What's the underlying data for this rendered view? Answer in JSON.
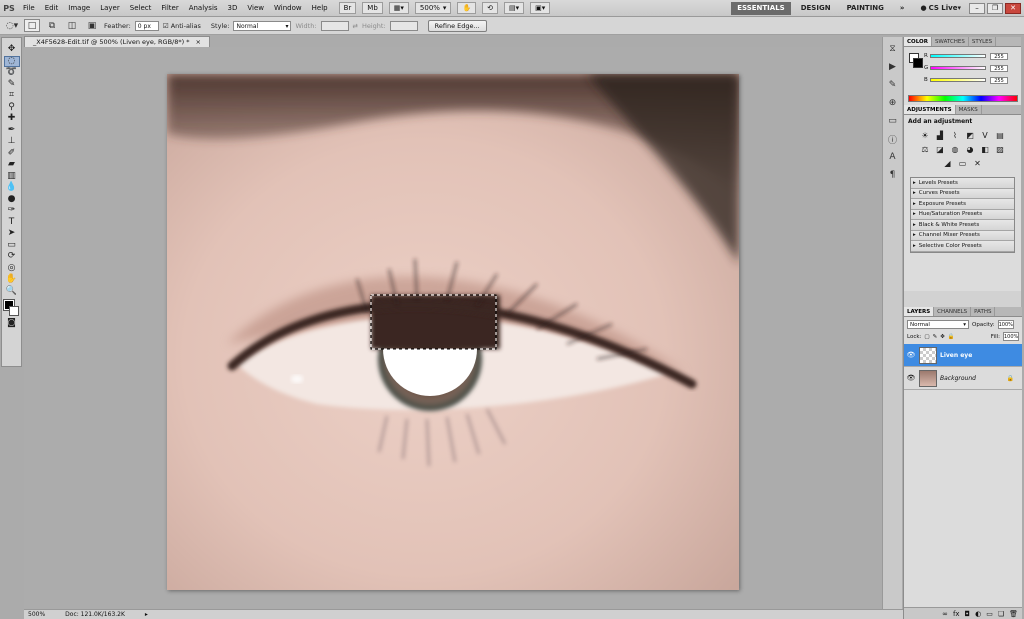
{
  "app": {
    "logo": "PS"
  },
  "menu": [
    "File",
    "Edit",
    "Image",
    "Layer",
    "Select",
    "Filter",
    "Analysis",
    "3D",
    "View",
    "Window",
    "Help"
  ],
  "menubar_controls": {
    "zoom": "500%"
  },
  "workspaces": [
    "ESSENTIALS",
    "DESIGN",
    "PAINTING"
  ],
  "cs_live": "CS Live",
  "options": {
    "feather_label": "Feather:",
    "feather_value": "0 px",
    "antialias_label": "Anti-alias",
    "style_label": "Style:",
    "style_value": "Normal",
    "width_label": "Width:",
    "height_label": "Height:",
    "refine_edge": "Refine Edge..."
  },
  "document": {
    "tab_title": "_X4F5628-Edit.tif @ 500% (Liven eye, RGB/8*) *",
    "close": "×"
  },
  "status": {
    "zoom": "500%",
    "doc": "Doc: 121.0K/163.2K"
  },
  "color_panel": {
    "tabs": [
      "COLOR",
      "SWATCHES",
      "STYLES"
    ],
    "r": "R",
    "g": "G",
    "b": "B",
    "r_value": "255",
    "g_value": "255",
    "b_value": "255"
  },
  "adjustments_panel": {
    "tabs": [
      "ADJUSTMENTS",
      "MASKS"
    ],
    "heading": "Add an adjustment",
    "presets": [
      "Levels Presets",
      "Curves Presets",
      "Exposure Presets",
      "Hue/Saturation Presets",
      "Black & White Presets",
      "Channel Mixer Presets",
      "Selective Color Presets"
    ]
  },
  "layers_panel": {
    "tabs": [
      "LAYERS",
      "CHANNELS",
      "PATHS"
    ],
    "blend_mode": "Normal",
    "opacity_label": "Opacity:",
    "opacity_value": "100%",
    "lock_label": "Lock:",
    "fill_label": "Fill:",
    "fill_value": "100%",
    "layers": [
      {
        "name": "Liven eye",
        "selected": true
      },
      {
        "name": "Background",
        "selected": false
      }
    ]
  },
  "colors": {
    "accent": "#3e8be2",
    "canvas_bg": "#acacac"
  }
}
